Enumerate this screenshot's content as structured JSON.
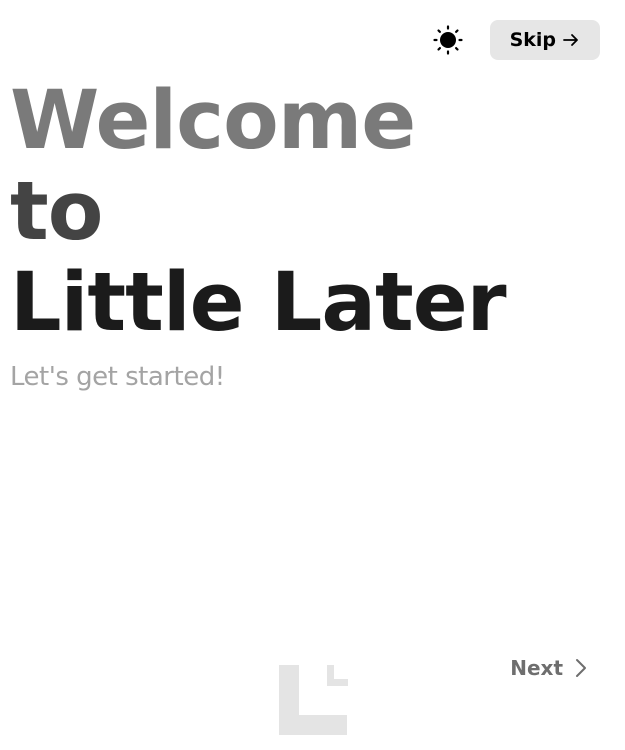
{
  "header": {
    "theme_icon": "sun-icon",
    "skip_label": "Skip",
    "skip_icon": "arrow-right-icon"
  },
  "hero": {
    "line1": "Welcome",
    "line2": "to",
    "line3": "Little Later",
    "subtitle": "Let's get started!"
  },
  "footer": {
    "next_label": "Next",
    "next_icon": "chevron-right-icon",
    "logo_icon": "little-later-logo-icon"
  },
  "colors": {
    "line1": "#7a7a7a",
    "line2": "#444444",
    "line3": "#1b1b1b",
    "subtitle": "#a4a4a4",
    "skip_bg": "#e6e6e6",
    "next_text": "#6e6e6e",
    "logo": "#e4e4e4"
  }
}
